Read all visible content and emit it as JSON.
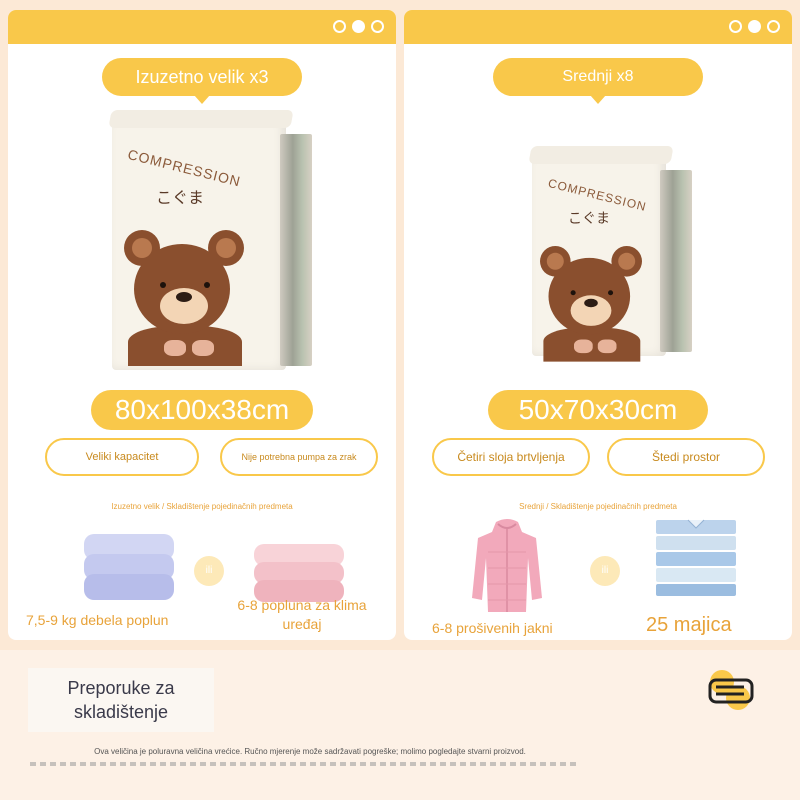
{
  "cards": [
    {
      "title": "Izuzetno velik x3",
      "bag_brand": "COMPRESSION",
      "bag_sub": "こぐま",
      "size": "80x100x38cm",
      "features": [
        "Veliki kapacitet",
        "Nije potrebna pumpa za zrak"
      ],
      "breadcrumb": "Izuzetno velik / Skladištenje pojedinačnih predmeta",
      "items": [
        {
          "label": "7,5-9 kg debela poplun",
          "icon": "lavender-quilt-icon"
        },
        {
          "label": "6-8 popluna za klima uređaj",
          "icon": "pink-quilt-icon"
        }
      ],
      "separator": "ili"
    },
    {
      "title": "Srednji x8",
      "bag_brand": "COMPRESSION",
      "bag_sub": "こぐま",
      "size": "50x70x30cm",
      "features": [
        "Četiri sloja brtvljenja",
        "Štedi prostor"
      ],
      "breadcrumb": "Srednji / Skladištenje pojedinačnih predmeta",
      "items": [
        {
          "label": "6-8 prošivenih jakni",
          "icon": "pink-jacket-icon"
        },
        {
          "label": "25 majica",
          "icon": "folded-shirts-icon"
        }
      ],
      "separator": "ili"
    }
  ],
  "bottom": {
    "recommendations": "Preporuke za skladištenje",
    "disclaimer": "Ova veličina je poluravna veličina vrećice. Ručno mjerenje može sadržavati pogreške; molimo pogledajte stvarni proizvod."
  },
  "colors": {
    "accent": "#f9c84a",
    "accent_text": "#e8a33a",
    "background": "#fce9d6"
  }
}
